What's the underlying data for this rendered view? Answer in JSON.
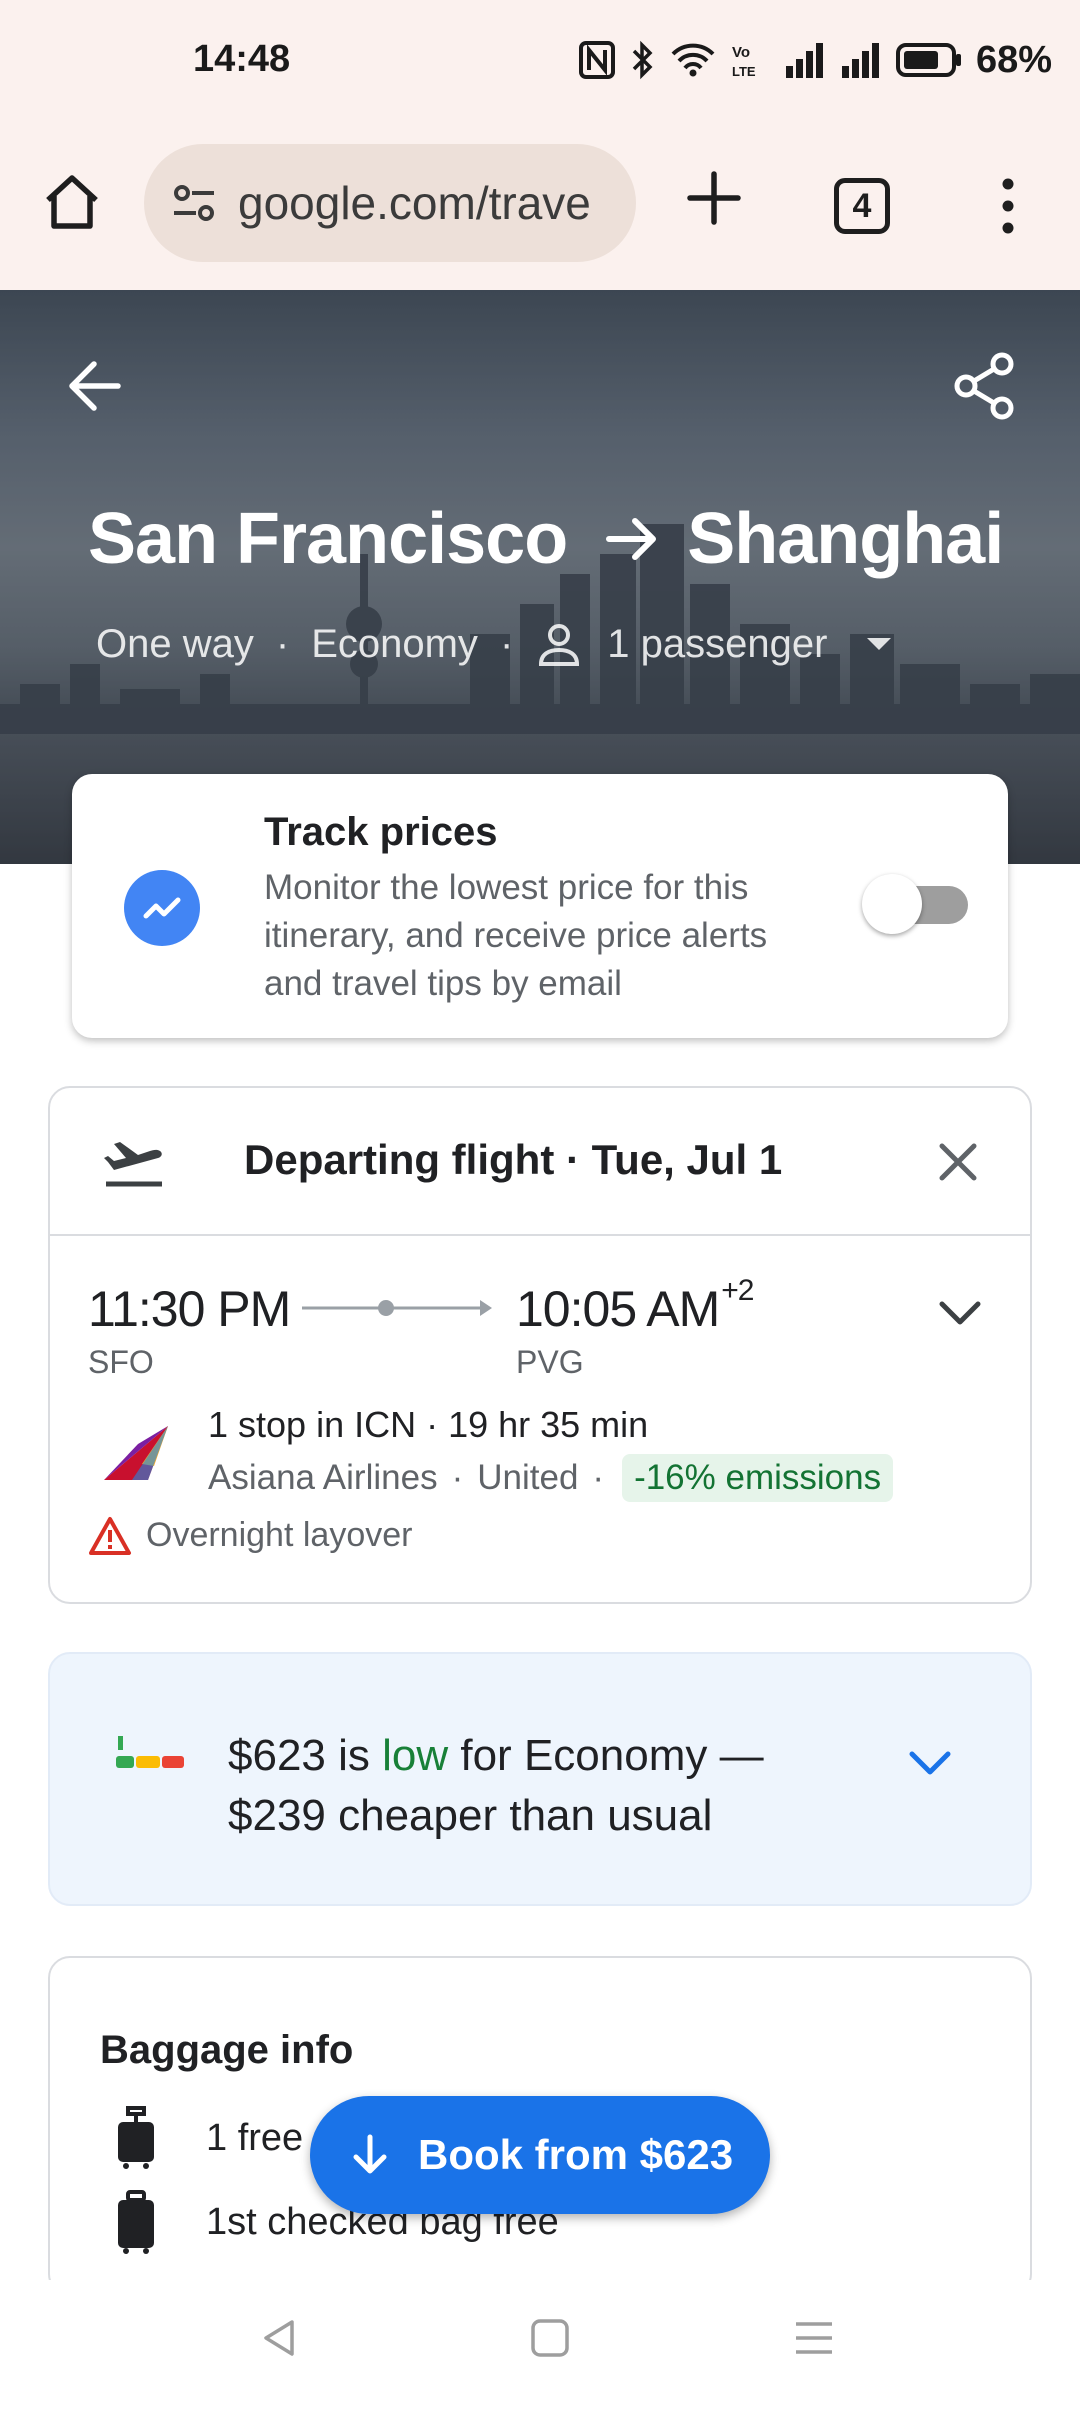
{
  "status_bar": {
    "time": "14:48",
    "battery": "68%"
  },
  "browser": {
    "url": "google.com/trave",
    "tab_count": "4"
  },
  "hero": {
    "origin": "San Francisco",
    "destination": "Shanghai",
    "trip_type": "One way",
    "cabin": "Economy",
    "passengers": "1 passenger"
  },
  "track_prices": {
    "title": "Track prices",
    "description": "Monitor the lowest price for this itinerary, and receive price alerts and travel tips by email",
    "enabled": false
  },
  "flight": {
    "header": "Departing flight · Tue, Jul 1",
    "depart_time": "11:30 PM",
    "depart_airport": "SFO",
    "arrive_time": "10:05 AM",
    "arrive_day_offset": "+2",
    "arrive_airport": "PVG",
    "stops": "1 stop in ICN · 19 hr 35 min",
    "airline_1": "Asiana Airlines",
    "airline_2": "United",
    "emissions": "-16% emissions",
    "warning": "Overnight layover"
  },
  "price_insight": {
    "part1": "$623 is ",
    "low": "low",
    "part2": " for Economy — $239 cheaper than usual"
  },
  "baggage": {
    "title": "Baggage info",
    "carry_on": "1 free",
    "checked": "1st checked bag free"
  },
  "book_button": {
    "label": "Book from $623"
  },
  "colors": {
    "accent": "#1a73e8",
    "low_green": "#188038",
    "browser_bg": "#fbf1ee"
  }
}
